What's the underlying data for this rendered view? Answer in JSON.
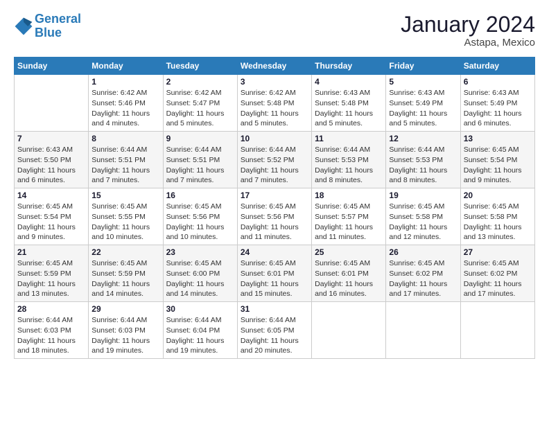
{
  "logo": {
    "line1": "General",
    "line2": "Blue"
  },
  "title": "January 2024",
  "subtitle": "Astapa, Mexico",
  "days_of_week": [
    "Sunday",
    "Monday",
    "Tuesday",
    "Wednesday",
    "Thursday",
    "Friday",
    "Saturday"
  ],
  "weeks": [
    [
      {
        "day": "",
        "sunrise": "",
        "sunset": "",
        "daylight": ""
      },
      {
        "day": "1",
        "sunrise": "Sunrise: 6:42 AM",
        "sunset": "Sunset: 5:46 PM",
        "daylight": "Daylight: 11 hours and 4 minutes."
      },
      {
        "day": "2",
        "sunrise": "Sunrise: 6:42 AM",
        "sunset": "Sunset: 5:47 PM",
        "daylight": "Daylight: 11 hours and 5 minutes."
      },
      {
        "day": "3",
        "sunrise": "Sunrise: 6:42 AM",
        "sunset": "Sunset: 5:48 PM",
        "daylight": "Daylight: 11 hours and 5 minutes."
      },
      {
        "day": "4",
        "sunrise": "Sunrise: 6:43 AM",
        "sunset": "Sunset: 5:48 PM",
        "daylight": "Daylight: 11 hours and 5 minutes."
      },
      {
        "day": "5",
        "sunrise": "Sunrise: 6:43 AM",
        "sunset": "Sunset: 5:49 PM",
        "daylight": "Daylight: 11 hours and 5 minutes."
      },
      {
        "day": "6",
        "sunrise": "Sunrise: 6:43 AM",
        "sunset": "Sunset: 5:49 PM",
        "daylight": "Daylight: 11 hours and 6 minutes."
      }
    ],
    [
      {
        "day": "7",
        "sunrise": "Sunrise: 6:43 AM",
        "sunset": "Sunset: 5:50 PM",
        "daylight": "Daylight: 11 hours and 6 minutes."
      },
      {
        "day": "8",
        "sunrise": "Sunrise: 6:44 AM",
        "sunset": "Sunset: 5:51 PM",
        "daylight": "Daylight: 11 hours and 7 minutes."
      },
      {
        "day": "9",
        "sunrise": "Sunrise: 6:44 AM",
        "sunset": "Sunset: 5:51 PM",
        "daylight": "Daylight: 11 hours and 7 minutes."
      },
      {
        "day": "10",
        "sunrise": "Sunrise: 6:44 AM",
        "sunset": "Sunset: 5:52 PM",
        "daylight": "Daylight: 11 hours and 7 minutes."
      },
      {
        "day": "11",
        "sunrise": "Sunrise: 6:44 AM",
        "sunset": "Sunset: 5:53 PM",
        "daylight": "Daylight: 11 hours and 8 minutes."
      },
      {
        "day": "12",
        "sunrise": "Sunrise: 6:44 AM",
        "sunset": "Sunset: 5:53 PM",
        "daylight": "Daylight: 11 hours and 8 minutes."
      },
      {
        "day": "13",
        "sunrise": "Sunrise: 6:45 AM",
        "sunset": "Sunset: 5:54 PM",
        "daylight": "Daylight: 11 hours and 9 minutes."
      }
    ],
    [
      {
        "day": "14",
        "sunrise": "Sunrise: 6:45 AM",
        "sunset": "Sunset: 5:54 PM",
        "daylight": "Daylight: 11 hours and 9 minutes."
      },
      {
        "day": "15",
        "sunrise": "Sunrise: 6:45 AM",
        "sunset": "Sunset: 5:55 PM",
        "daylight": "Daylight: 11 hours and 10 minutes."
      },
      {
        "day": "16",
        "sunrise": "Sunrise: 6:45 AM",
        "sunset": "Sunset: 5:56 PM",
        "daylight": "Daylight: 11 hours and 10 minutes."
      },
      {
        "day": "17",
        "sunrise": "Sunrise: 6:45 AM",
        "sunset": "Sunset: 5:56 PM",
        "daylight": "Daylight: 11 hours and 11 minutes."
      },
      {
        "day": "18",
        "sunrise": "Sunrise: 6:45 AM",
        "sunset": "Sunset: 5:57 PM",
        "daylight": "Daylight: 11 hours and 11 minutes."
      },
      {
        "day": "19",
        "sunrise": "Sunrise: 6:45 AM",
        "sunset": "Sunset: 5:58 PM",
        "daylight": "Daylight: 11 hours and 12 minutes."
      },
      {
        "day": "20",
        "sunrise": "Sunrise: 6:45 AM",
        "sunset": "Sunset: 5:58 PM",
        "daylight": "Daylight: 11 hours and 13 minutes."
      }
    ],
    [
      {
        "day": "21",
        "sunrise": "Sunrise: 6:45 AM",
        "sunset": "Sunset: 5:59 PM",
        "daylight": "Daylight: 11 hours and 13 minutes."
      },
      {
        "day": "22",
        "sunrise": "Sunrise: 6:45 AM",
        "sunset": "Sunset: 5:59 PM",
        "daylight": "Daylight: 11 hours and 14 minutes."
      },
      {
        "day": "23",
        "sunrise": "Sunrise: 6:45 AM",
        "sunset": "Sunset: 6:00 PM",
        "daylight": "Daylight: 11 hours and 14 minutes."
      },
      {
        "day": "24",
        "sunrise": "Sunrise: 6:45 AM",
        "sunset": "Sunset: 6:01 PM",
        "daylight": "Daylight: 11 hours and 15 minutes."
      },
      {
        "day": "25",
        "sunrise": "Sunrise: 6:45 AM",
        "sunset": "Sunset: 6:01 PM",
        "daylight": "Daylight: 11 hours and 16 minutes."
      },
      {
        "day": "26",
        "sunrise": "Sunrise: 6:45 AM",
        "sunset": "Sunset: 6:02 PM",
        "daylight": "Daylight: 11 hours and 17 minutes."
      },
      {
        "day": "27",
        "sunrise": "Sunrise: 6:45 AM",
        "sunset": "Sunset: 6:02 PM",
        "daylight": "Daylight: 11 hours and 17 minutes."
      }
    ],
    [
      {
        "day": "28",
        "sunrise": "Sunrise: 6:44 AM",
        "sunset": "Sunset: 6:03 PM",
        "daylight": "Daylight: 11 hours and 18 minutes."
      },
      {
        "day": "29",
        "sunrise": "Sunrise: 6:44 AM",
        "sunset": "Sunset: 6:03 PM",
        "daylight": "Daylight: 11 hours and 19 minutes."
      },
      {
        "day": "30",
        "sunrise": "Sunrise: 6:44 AM",
        "sunset": "Sunset: 6:04 PM",
        "daylight": "Daylight: 11 hours and 19 minutes."
      },
      {
        "day": "31",
        "sunrise": "Sunrise: 6:44 AM",
        "sunset": "Sunset: 6:05 PM",
        "daylight": "Daylight: 11 hours and 20 minutes."
      },
      {
        "day": "",
        "sunrise": "",
        "sunset": "",
        "daylight": ""
      },
      {
        "day": "",
        "sunrise": "",
        "sunset": "",
        "daylight": ""
      },
      {
        "day": "",
        "sunrise": "",
        "sunset": "",
        "daylight": ""
      }
    ]
  ]
}
